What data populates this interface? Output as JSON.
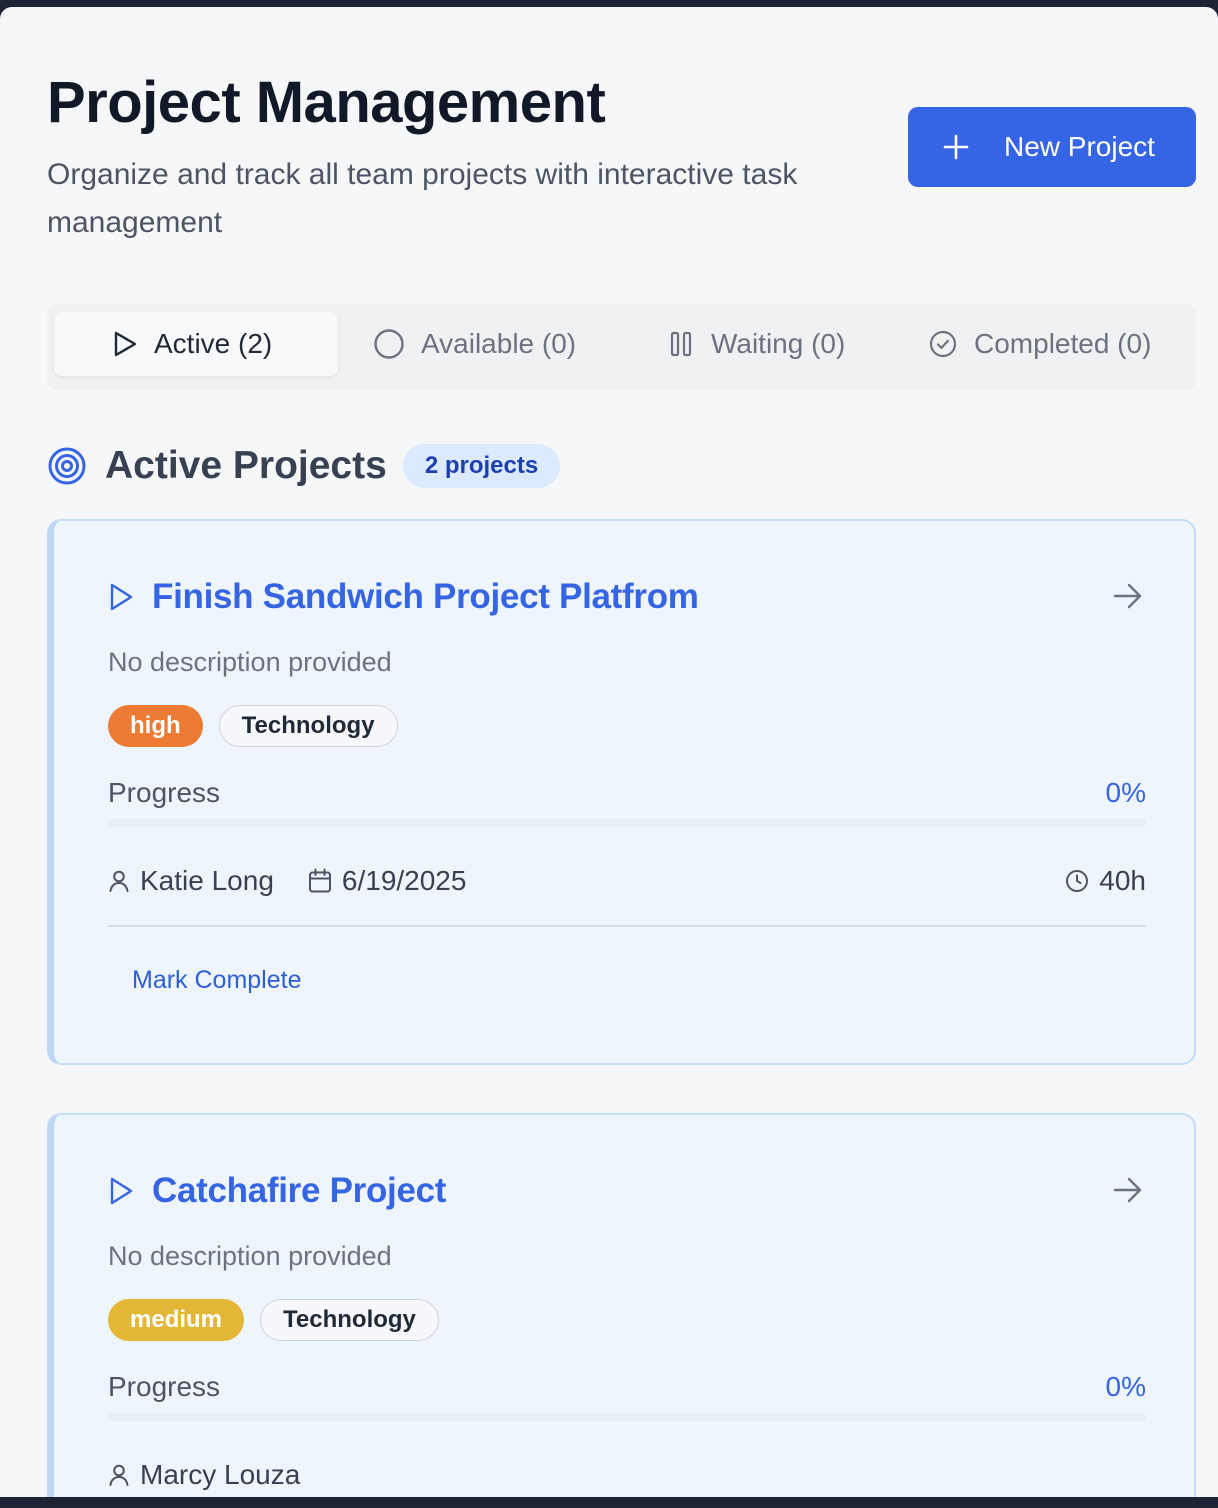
{
  "header": {
    "title": "Project Management",
    "subtitle": "Organize and track all team projects with interactive task management",
    "new_button_label": "New Project"
  },
  "tabs": [
    {
      "label": "Active (2)",
      "icon": "play-icon",
      "active": true
    },
    {
      "label": "Available (0)",
      "icon": "circle-icon",
      "active": false
    },
    {
      "label": "Waiting (0)",
      "icon": "pause-icon",
      "active": false
    },
    {
      "label": "Completed (0)",
      "icon": "check-circle-icon",
      "active": false
    }
  ],
  "section": {
    "title": "Active Projects",
    "badge": "2 projects",
    "icon": "target-icon"
  },
  "projects": [
    {
      "title": "Finish Sandwich Project Platfrom",
      "description": "No description provided",
      "priority": "high",
      "priority_color": "#ed7b34",
      "category": "Technology",
      "progress_label": "Progress",
      "progress_value": "0%",
      "progress_fraction": 0,
      "owner": "Katie Long",
      "due_date": "6/19/2025",
      "hours": "40h",
      "action_label": "Mark Complete"
    },
    {
      "title": "Catchafire Project",
      "description": "No description provided",
      "priority": "medium",
      "priority_color": "#e2b735",
      "category": "Technology",
      "progress_label": "Progress",
      "progress_value": "0%",
      "progress_fraction": 0,
      "owner": "Marcy Louza"
    }
  ],
  "colors": {
    "accent": "#3564e4",
    "card_bg": "#eff5fd",
    "card_border": "#c7dbf5"
  }
}
